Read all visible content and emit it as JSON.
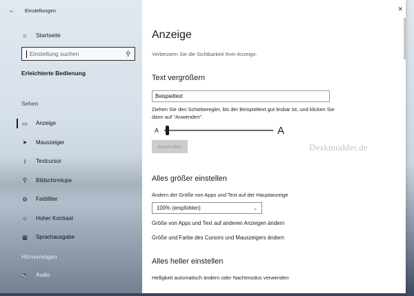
{
  "window": {
    "title": "Einstellungen"
  },
  "sidebar": {
    "home_label": "Startseite",
    "search_placeholder": "Einstellung suchen",
    "section_title": "Erleichterte Bedienung",
    "group_sehen": "Sehen",
    "items_sehen": [
      {
        "label": "Anzeige",
        "icon": "monitor-icon"
      },
      {
        "label": "Mauszeiger",
        "icon": "mouse-pointer-icon"
      },
      {
        "label": "Textcursor",
        "icon": "text-cursor-icon"
      },
      {
        "label": "Bildschirmlupe",
        "icon": "magnifier-icon"
      },
      {
        "label": "Farbfilter",
        "icon": "color-filter-icon"
      },
      {
        "label": "Hoher Kontrast",
        "icon": "contrast-icon"
      },
      {
        "label": "Sprachausgabe",
        "icon": "narrator-icon"
      }
    ],
    "group_hoeren": "Hörvermögen",
    "items_hoeren": [
      {
        "label": "Audio",
        "icon": "speaker-icon"
      }
    ]
  },
  "content": {
    "title": "Anzeige",
    "subtitle": "Verbessern Sie die Sichtbarkeit Ihrer Anzeige.",
    "text_section": {
      "heading": "Text vergrößern",
      "sample_text": "Beispieltext",
      "description": "Ziehen Sie den Schieberegler, bis der Beispieltext gut lesbar ist, und klicken Sie dann auf \"Anwenden\".",
      "slider_min_label": "A",
      "slider_max_label": "A",
      "slider_value": 0,
      "apply_label": "Anwenden"
    },
    "size_section": {
      "heading": "Alles größer einstellen",
      "label": "Ändern der Größe von Apps und Text auf der Hauptanzeige",
      "selected": "100% (empfohlen)",
      "link1": "Größe von Apps und Text auf anderen Anzeigen ändern",
      "link2": "Größe und Farbe des Cursors und Mauszeigers ändern"
    },
    "bright_section": {
      "heading": "Alles heller einstellen",
      "label": "Helligkeit automatisch ändern oder Nachtmodus verwenden"
    }
  },
  "watermark": "Deskmodder.de"
}
